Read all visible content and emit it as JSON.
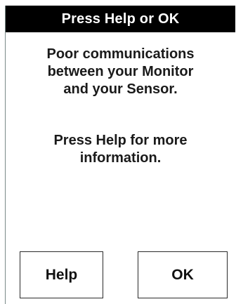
{
  "dialog": {
    "title": "Press Help or OK",
    "message_lines": [
      "Poor communications",
      "between your Monitor",
      "and your Sensor."
    ],
    "hint_lines": [
      "Press Help for more",
      "information."
    ],
    "buttons": {
      "help_label": "Help",
      "ok_label": "OK"
    }
  },
  "colors": {
    "title_bar_background": "#000000",
    "title_text": "#ffffff",
    "body_background": "#ffffff",
    "text": "#1a1a1a"
  }
}
